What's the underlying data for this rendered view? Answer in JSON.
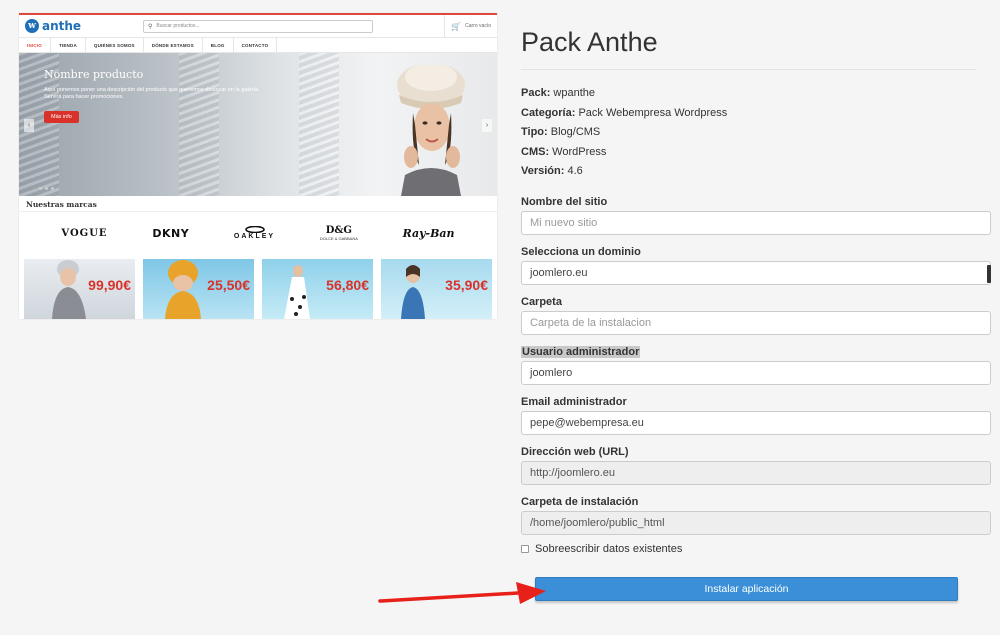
{
  "preview": {
    "logo_mark": "w",
    "logo_text": "anthe",
    "search_placeholder": "Buscar productos...",
    "cart_label": "Carro vacío",
    "nav": [
      "INICIO",
      "TIENDA",
      "QUIÉNES SOMOS",
      "DÓNDE ESTAMOS",
      "BLOG",
      "CONTACTO"
    ],
    "hero": {
      "title": "Nombre producto",
      "description": "Aquí ponemos poner una descripción del producto que queremos destacar en la galería. Servirá para hacer promociones.",
      "button": "Más info"
    },
    "brands_title": "Nuestras marcas",
    "brands": [
      "VOGUE",
      "DKNY",
      "OAKLEY",
      "D&G",
      "Ray-Ban"
    ],
    "brand_dg_sub": "DOLCE & GABBANA",
    "prices": [
      "99,90€",
      "25,50€",
      "56,80€",
      "35,90€"
    ]
  },
  "form": {
    "title": "Pack Anthe",
    "meta": [
      {
        "key": "Pack:",
        "value": "wpanthe"
      },
      {
        "key": "Categoría:",
        "value": "Pack Webempresa Wordpress"
      },
      {
        "key": "Tipo:",
        "value": "Blog/CMS"
      },
      {
        "key": "CMS:",
        "value": "WordPress"
      },
      {
        "key": "Versión:",
        "value": "4.6"
      }
    ],
    "site_name_label": "Nombre del sitio",
    "site_name_placeholder": "Mi nuevo sitio",
    "domain_label": "Selecciona un dominio",
    "domain_value": "joomlero.eu",
    "folder_label": "Carpeta",
    "folder_placeholder": "Carpeta de la instalacion",
    "admin_user_label": "Usuario administrador",
    "admin_user_value": "joomlero",
    "admin_email_label": "Email administrador",
    "admin_email_value": "pepe@webempresa.eu",
    "url_label": "Dirección web (URL)",
    "url_value": "http://joomlero.eu",
    "install_folder_label": "Carpeta de instalación",
    "install_folder_value": "/home/joomlero/public_html",
    "overwrite_label": "Sobreescribir datos existentes",
    "install_button": "Instalar aplicación"
  },
  "colors": {
    "accent_red": "#e0483e",
    "button_blue": "#3b8fd8",
    "arrow_red": "#e8201a"
  }
}
